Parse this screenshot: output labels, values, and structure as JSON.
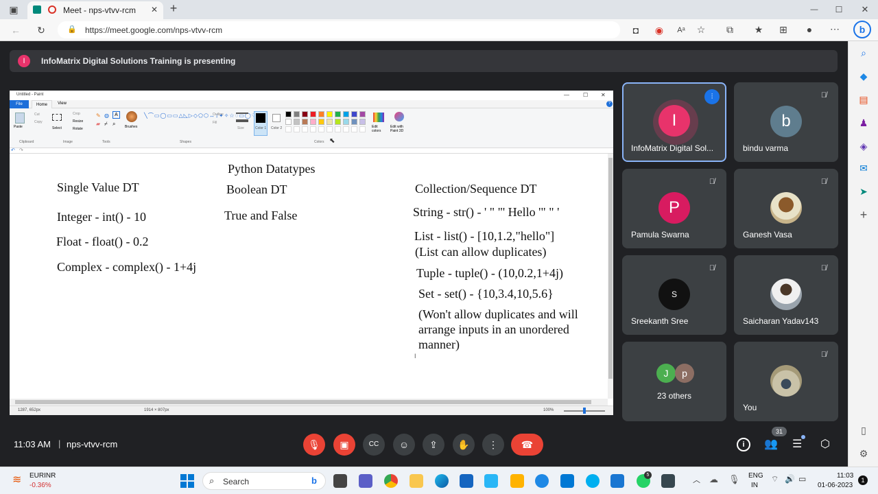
{
  "browser": {
    "tab_title": "Meet - nps-vtvv-rcm",
    "url": "https://meet.google.com/nps-vtvv-rcm",
    "new_tab": "+",
    "win_min": "—",
    "win_max": "☐",
    "win_close": "✕"
  },
  "banner": {
    "initial": "I",
    "text": "InfoMatrix Digital Solutions Training is presenting"
  },
  "paint": {
    "window_title": "Untitled - Paint",
    "tabs": [
      "File",
      "Home",
      "View"
    ],
    "groups": [
      "Clipboard",
      "Image",
      "Tools",
      "Shapes",
      "Colors"
    ],
    "buttons": {
      "paste": "Paste",
      "cut": "Cut",
      "copy": "Copy",
      "select": "Select",
      "crop": "Crop",
      "resize": "Resize",
      "rotate": "Rotate",
      "brushes": "Brushes",
      "outline": "Outline",
      "fill": "Fill",
      "size": "Size",
      "color1": "Color 1",
      "color2": "Color 2",
      "edit_colors": "Edit colors",
      "edit_3d": "Edit with Paint 3D"
    },
    "status": {
      "cursor": "1287, 652px",
      "dimensions": "1914 × 807px",
      "zoom": "100%"
    },
    "canvas": {
      "title": "Python Datatypes",
      "col1_heading": "Single Value DT",
      "col1_items": [
        "Integer - int() - 10",
        "Float - float() - 0.2",
        "Complex - complex() - 1+4j"
      ],
      "col2_heading": "Boolean DT",
      "col2_items": [
        "True and False"
      ],
      "col3_heading": "Collection/Sequence DT",
      "col3_items": [
        "String - str() - ' \" \"' Hello '\" \" '",
        "List - list() - [10,1.2,\"hello\"]",
        "(List can allow duplicates)",
        "Tuple - tuple() - (10,0.2,1+4j)",
        "Set - set() - {10,3.4,10,5.6}",
        "(Won't allow duplicates and will",
        "arrange inputs in an unordered",
        "manner)"
      ]
    },
    "palette": [
      "#000000",
      "#7f7f7f",
      "#880015",
      "#ed1c24",
      "#ff7f27",
      "#fff200",
      "#22b14c",
      "#00a2e8",
      "#3f48cc",
      "#a349a4",
      "#ffffff",
      "#c3c3c3",
      "#b97a57",
      "#ffaec9",
      "#ffc90e",
      "#efe4b0",
      "#b5e61d",
      "#99d9ea",
      "#7092be",
      "#c8bfe7"
    ]
  },
  "participants": [
    {
      "initial": "I",
      "name": "InfoMatrix Digital Sol...",
      "color": "#e8336b",
      "speaking": true
    },
    {
      "initial": "b",
      "name": "bindu varma",
      "color": "#5f7d8e"
    },
    {
      "initial": "P",
      "name": "Pamula Swarna",
      "color": "#d81b60"
    },
    {
      "initial": "",
      "name": "Ganesh Vasa",
      "color": "#c8b48a"
    },
    {
      "initial": "S",
      "name": "Sreekanth Sree",
      "color": "#111111"
    },
    {
      "initial": "",
      "name": "Saicharan Yadav143",
      "color": "#9aa4ad"
    },
    {
      "initial": "",
      "name": "You",
      "color": "#a59a78"
    }
  ],
  "others": {
    "avatars": [
      {
        "initial": "J",
        "color": "#4caf50"
      },
      {
        "initial": "p",
        "color": "#8d6e63"
      }
    ],
    "label": "23 others"
  },
  "meeting": {
    "time": "11:03 AM",
    "separator": "|",
    "code": "nps-vtvv-rcm",
    "people_count": "31"
  },
  "taskbar": {
    "currency": "EURINR",
    "currency_change": "-0.36%",
    "search": "Search",
    "lang": "ENG",
    "lang_region": "IN",
    "time": "11:03",
    "date": "01-06-2023",
    "notification_count": "1",
    "whatsapp_badge": "5"
  },
  "colors": {
    "meet_bg": "#202124",
    "tile_bg": "#3c4043",
    "end_call": "#ea4335",
    "accent": "#8ab4f8"
  }
}
